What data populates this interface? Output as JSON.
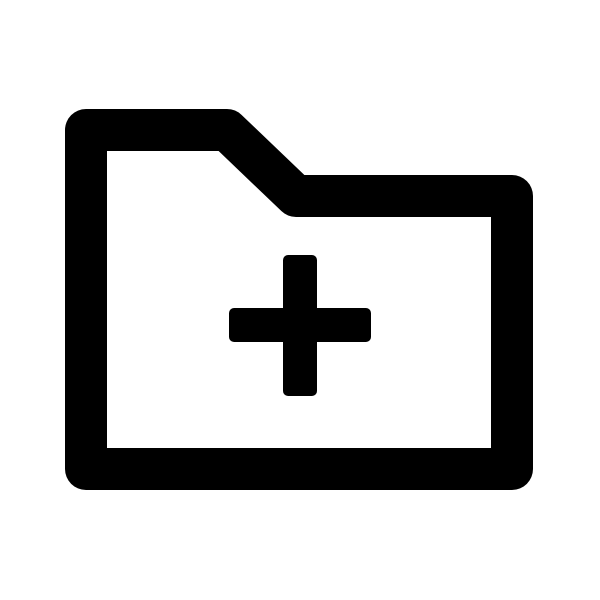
{
  "icon": {
    "name": "folder-add-icon",
    "stroke_color": "#000000",
    "background_color": "#ffffff"
  }
}
